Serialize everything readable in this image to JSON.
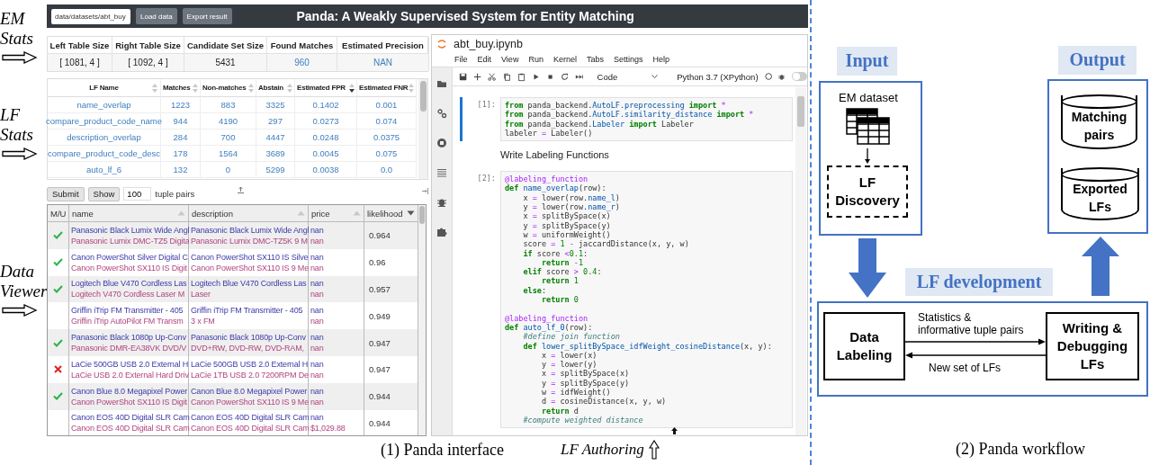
{
  "annotations": [
    {
      "text": "EM Stats"
    },
    {
      "text": "LF Stats"
    },
    {
      "text": "Data Viewer"
    }
  ],
  "app": {
    "path_field": {
      "value": "data/datasets/abt_buy"
    },
    "buttons": [
      "Load data",
      "Export result"
    ],
    "title": "Panda: A Weakly Supervised System for Entity Matching"
  },
  "em_stats": {
    "columns": [
      "Left Table Size",
      "Right Table Size",
      "Candidate Set Size",
      "Found Matches",
      "Estimated Precision"
    ],
    "values": [
      {
        "text": "[ 1081, 4 ]",
        "link": false
      },
      {
        "text": "[ 1092, 4 ]",
        "link": false
      },
      {
        "text": "5431",
        "link": false
      },
      {
        "text": "960",
        "link": true
      },
      {
        "text": "NAN",
        "link": true
      }
    ]
  },
  "lf_stats": {
    "columns": [
      {
        "label": "LF Name",
        "sortable": true,
        "sorted": false
      },
      {
        "label": "Matches",
        "sortable": true,
        "sorted": false
      },
      {
        "label": "Non-matches",
        "sortable": true,
        "sorted": false
      },
      {
        "label": "Abstain",
        "sortable": true,
        "sorted": false
      },
      {
        "label": "Estimated FPR",
        "sortable": true,
        "sorted": true
      },
      {
        "label": "Estimated FNR",
        "sortable": true,
        "sorted": false
      }
    ],
    "rows": [
      [
        "name_overlap",
        "1223",
        "883",
        "3325",
        "0.1402",
        "0.001"
      ],
      [
        "compare_product_code_name",
        "944",
        "4190",
        "297",
        "0.0273",
        "0.074"
      ],
      [
        "description_overlap",
        "284",
        "700",
        "4447",
        "0.0248",
        "0.0375"
      ],
      [
        "compare_product_code_desc",
        "178",
        "1564",
        "3689",
        "0.0045",
        "0.075"
      ],
      [
        "auto_lf_6",
        "132",
        "0",
        "5299",
        "0.0038",
        "0.0"
      ]
    ]
  },
  "data_viewer": {
    "buttons": [
      "Submit",
      "Show"
    ],
    "count_field": {
      "value": "100"
    },
    "count_label": "tuple pairs",
    "columns": [
      {
        "label": "M/U",
        "sortable": false,
        "sorted": false
      },
      {
        "label": "name",
        "sortable": true,
        "sorted": false
      },
      {
        "label": "description",
        "sortable": true,
        "sorted": false
      },
      {
        "label": "price",
        "sortable": true,
        "sorted": false
      },
      {
        "label": "likelihood",
        "sortable": true,
        "sorted": true
      }
    ],
    "rows": [
      {
        "kind": "match",
        "name": [
          "Panasonic Black Lumix Wide Angl",
          "Panasonic Lumix DMC-TZ5 Digita"
        ],
        "description": [
          "Panasonic Black Lumix Wide Angl",
          "Panasonic Lumix DMC-TZ5K 9 M"
        ],
        "price": [
          "nan",
          "nan"
        ],
        "likelihood": "0.964"
      },
      {
        "kind": "match",
        "name": [
          "Canon PowerShot Silver Digital C",
          "Canon PowerShot SX110 IS Digit"
        ],
        "description": [
          "Canon PowerShot SX110 IS Silve",
          "Canon PowerShot SX110 IS 9 Me"
        ],
        "price": [
          "nan",
          "nan"
        ],
        "likelihood": "0.96"
      },
      {
        "kind": "match",
        "name": [
          "Logitech Blue V470 Cordless Las",
          "Logitech V470 Cordless Laser M"
        ],
        "description": [
          "Logitech Blue V470 Cordless Las",
          "Laser"
        ],
        "price": [
          "nan",
          "nan"
        ],
        "likelihood": "0.957"
      },
      {
        "kind": "unlabeled",
        "name": [
          "Griffin iTrip FM Transmitter - 405",
          "Griffin iTrip AutoPilot FM Transm"
        ],
        "description": [
          "Griffin iTrip FM Transmitter - 405",
          "3 x FM"
        ],
        "price": [
          "nan",
          "nan"
        ],
        "likelihood": "0.949"
      },
      {
        "kind": "match",
        "name": [
          "Panasonic Black 1080p Up-Conv",
          "Panasonic DMR-EA38VK DVD/V"
        ],
        "description": [
          "Panasonic Black 1080p Up-Conv",
          "DVD+RW, DVD-RW, DVD-RAM,"
        ],
        "price": [
          "nan",
          "nan"
        ],
        "likelihood": "0.947"
      },
      {
        "kind": "nonmatch",
        "name": [
          "LaCie 500GB USB 2.0 External H",
          "LaCie USB 2.0 External Hard Driv"
        ],
        "description": [
          "LaCie 500GB USB 2.0 External H",
          "LaCie 1TB USB 2.0 7200RPM De"
        ],
        "price": [
          "nan",
          "nan"
        ],
        "likelihood": "0.947"
      },
      {
        "kind": "match",
        "name": [
          "Canon Blue 8.0 Megapixel Power",
          "Canon PowerShot SX110 IS Digit"
        ],
        "description": [
          "Canon Blue 8.0 Megapixel Power",
          "Canon PowerShot SX110 IS 9 Me"
        ],
        "price": [
          "nan",
          "nan"
        ],
        "likelihood": "0.944"
      },
      {
        "kind": "unlabeled",
        "name": [
          "Canon EOS 40D Digital SLR Cam",
          "Canon EOS 40D Digital SLR Cam"
        ],
        "description": [
          "Canon EOS 40D Digital SLR Cam",
          "Canon EOS 40D Digital SLR Cam"
        ],
        "price": [
          "nan",
          "$1,029.88"
        ],
        "likelihood": "0.944"
      }
    ]
  },
  "notebook": {
    "tab": "abt_buy.ipynb",
    "menu": [
      "File",
      "Edit",
      "View",
      "Run",
      "Kernel",
      "Tabs",
      "Settings",
      "Help"
    ],
    "cell_type": "Code",
    "kernel": "Python 3.7 (XPython)",
    "debugger_on": false,
    "cells": [
      {
        "kind": "code",
        "prompt": "[1]:",
        "active": true,
        "blocks": [
          [
            [
              {
                "kind": "keyword",
                "text": "from"
              },
              {
                "kind": "plain",
                "text": " panda_backend."
              },
              {
                "kind": "name",
                "text": "AutoLF.preprocessing"
              },
              {
                "kind": "keyword",
                "text": " import"
              },
              {
                "kind": "operator",
                "text": " *"
              }
            ],
            [
              {
                "kind": "keyword",
                "text": "from"
              },
              {
                "kind": "plain",
                "text": " panda_backend."
              },
              {
                "kind": "name",
                "text": "AutoLF.similarity_distance"
              },
              {
                "kind": "keyword",
                "text": " import"
              },
              {
                "kind": "operator",
                "text": " *"
              }
            ],
            [
              {
                "kind": "keyword",
                "text": "from"
              },
              {
                "kind": "plain",
                "text": " panda_backend."
              },
              {
                "kind": "name",
                "text": "Labeler"
              },
              {
                "kind": "keyword",
                "text": " import"
              },
              {
                "kind": "plain",
                "text": " Labeler"
              }
            ],
            [
              {
                "kind": "plain",
                "text": "labeler"
              },
              {
                "kind": "operator",
                "text": " ="
              },
              {
                "kind": "plain",
                "text": " Labeler()"
              }
            ]
          ]
        ]
      },
      {
        "kind": "markdown",
        "text": "Write Labeling Functions"
      },
      {
        "kind": "code",
        "prompt": "[2]:",
        "active": false,
        "blocks": [
          [
            [
              {
                "kind": "decorator",
                "text": "@labeling_function"
              }
            ],
            [
              {
                "kind": "keyword",
                "text": "def"
              },
              {
                "kind": "name",
                "text": " name_overlap"
              },
              {
                "kind": "plain",
                "text": "(row):"
              }
            ],
            [
              {
                "kind": "plain",
                "text": "    x"
              },
              {
                "kind": "operator",
                "text": " ="
              },
              {
                "kind": "plain",
                "text": " lower(row."
              },
              {
                "kind": "name",
                "text": "name_l"
              },
              {
                "kind": "plain",
                "text": ")"
              }
            ],
            [
              {
                "kind": "plain",
                "text": "    y"
              },
              {
                "kind": "operator",
                "text": " ="
              },
              {
                "kind": "plain",
                "text": " lower(row."
              },
              {
                "kind": "name",
                "text": "name_r"
              },
              {
                "kind": "plain",
                "text": ")"
              }
            ],
            [
              {
                "kind": "plain",
                "text": "    x"
              },
              {
                "kind": "operator",
                "text": " ="
              },
              {
                "kind": "plain",
                "text": " splitBySpace(x)"
              }
            ],
            [
              {
                "kind": "plain",
                "text": "    y"
              },
              {
                "kind": "operator",
                "text": " ="
              },
              {
                "kind": "plain",
                "text": " splitBySpace(y)"
              }
            ],
            [
              {
                "kind": "plain",
                "text": "    w"
              },
              {
                "kind": "operator",
                "text": " ="
              },
              {
                "kind": "plain",
                "text": " uniformWeight()"
              }
            ],
            [
              {
                "kind": "plain",
                "text": "    score"
              },
              {
                "kind": "operator",
                "text": " ="
              },
              {
                "kind": "number",
                "text": " 1"
              },
              {
                "kind": "operator",
                "text": " -"
              },
              {
                "kind": "plain",
                "text": " jaccardDistance(x, y, w)"
              }
            ],
            [
              {
                "kind": "keyword",
                "text": "    if"
              },
              {
                "kind": "plain",
                "text": " score "
              },
              {
                "kind": "operator",
                "text": "<"
              },
              {
                "kind": "number",
                "text": "0.1"
              },
              {
                "kind": "plain",
                "text": ":"
              }
            ],
            [
              {
                "kind": "keyword",
                "text": "        return"
              },
              {
                "kind": "operator",
                "text": " -"
              },
              {
                "kind": "number",
                "text": "1"
              }
            ],
            [
              {
                "kind": "keyword",
                "text": "    elif"
              },
              {
                "kind": "plain",
                "text": " score"
              },
              {
                "kind": "operator",
                "text": " >"
              },
              {
                "kind": "number",
                "text": " 0.4"
              },
              {
                "kind": "plain",
                "text": ":"
              }
            ],
            [
              {
                "kind": "keyword",
                "text": "        return"
              },
              {
                "kind": "number",
                "text": " 1"
              }
            ],
            [
              {
                "kind": "keyword",
                "text": "    else"
              },
              {
                "kind": "plain",
                "text": ":"
              }
            ],
            [
              {
                "kind": "keyword",
                "text": "        return"
              },
              {
                "kind": "number",
                "text": " 0"
              }
            ]
          ],
          [
            [
              {
                "kind": "decorator",
                "text": "@labeling_function"
              }
            ],
            [
              {
                "kind": "keyword",
                "text": "def"
              },
              {
                "kind": "name",
                "text": " auto_lf_0"
              },
              {
                "kind": "plain",
                "text": "(row):"
              }
            ],
            [
              {
                "kind": "comment",
                "text": "    #define join function"
              }
            ],
            [
              {
                "kind": "keyword",
                "text": "    def"
              },
              {
                "kind": "name",
                "text": " lower_splitBySpace_idfWeight_cosineDistance"
              },
              {
                "kind": "plain",
                "text": "(x, y):"
              }
            ],
            [
              {
                "kind": "plain",
                "text": "        x"
              },
              {
                "kind": "operator",
                "text": " ="
              },
              {
                "kind": "plain",
                "text": " lower(x)"
              }
            ],
            [
              {
                "kind": "plain",
                "text": "        y"
              },
              {
                "kind": "operator",
                "text": " ="
              },
              {
                "kind": "plain",
                "text": " lower(y)"
              }
            ],
            [
              {
                "kind": "plain",
                "text": "        x"
              },
              {
                "kind": "operator",
                "text": " ="
              },
              {
                "kind": "plain",
                "text": " splitBySpace(x)"
              }
            ],
            [
              {
                "kind": "plain",
                "text": "        y"
              },
              {
                "kind": "operator",
                "text": " ="
              },
              {
                "kind": "plain",
                "text": " splitBySpace(y)"
              }
            ],
            [
              {
                "kind": "plain",
                "text": "        w"
              },
              {
                "kind": "operator",
                "text": " ="
              },
              {
                "kind": "plain",
                "text": " idfWeight()"
              }
            ],
            [
              {
                "kind": "plain",
                "text": "        d"
              },
              {
                "kind": "operator",
                "text": " ="
              },
              {
                "kind": "plain",
                "text": " cosineDistance(x, y, w)"
              }
            ],
            [
              {
                "kind": "keyword",
                "text": "        return"
              },
              {
                "kind": "plain",
                "text": " d"
              }
            ],
            [
              {
                "kind": "comment",
                "text": "    #compute weighted distance"
              }
            ]
          ]
        ]
      }
    ]
  },
  "interface_caption": "(1) Panda interface",
  "authoring_annotation": "LF Authoring",
  "workflow": {
    "input_label": "Input",
    "dataset_label": "EM dataset",
    "discovery_label": "LF Discovery",
    "output_label": "Output",
    "outputs": [
      "Matching pairs",
      "Exported LFs"
    ],
    "development_label": "LF development",
    "data_labeling": "Data Labeling",
    "writing": "Writing & Debugging LFs",
    "forward_label": "Statistics & informative tuple pairs",
    "backward_label": "New set of LFs",
    "caption": "(2) Panda workflow"
  }
}
